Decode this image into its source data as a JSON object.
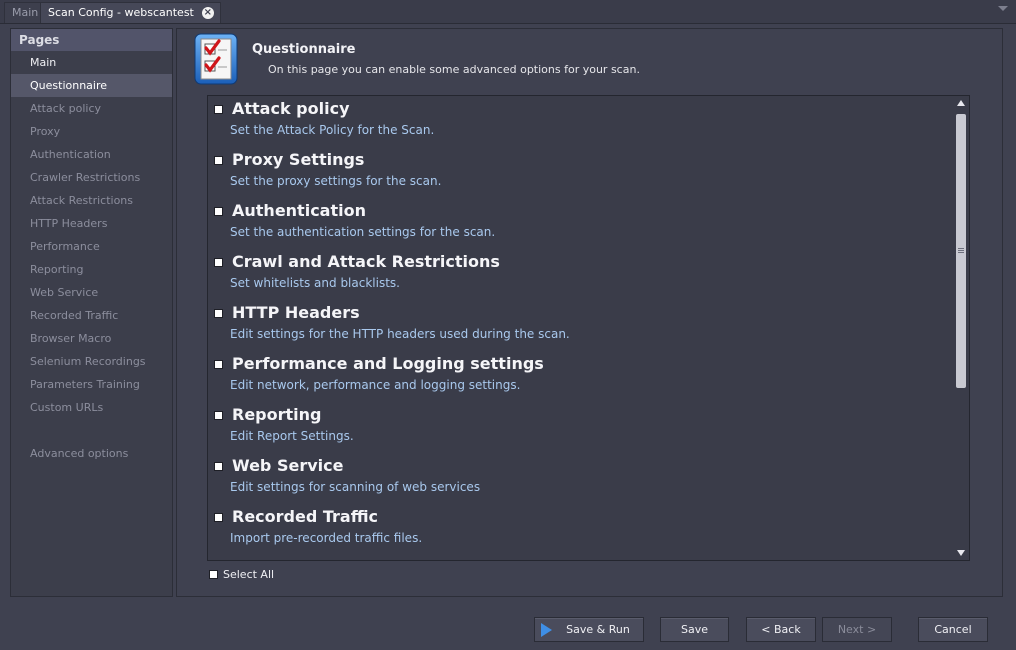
{
  "tabs": [
    {
      "label": "Main",
      "active": false
    },
    {
      "label": "Scan Config - webscantest",
      "active": true
    }
  ],
  "sidebar": {
    "header": "Pages",
    "items": [
      {
        "label": "Main",
        "state": "normal"
      },
      {
        "label": "Questionnaire",
        "state": "selected"
      },
      {
        "label": "Attack policy",
        "state": "disabled"
      },
      {
        "label": "Proxy",
        "state": "disabled"
      },
      {
        "label": "Authentication",
        "state": "disabled"
      },
      {
        "label": "Crawler Restrictions",
        "state": "disabled"
      },
      {
        "label": "Attack Restrictions",
        "state": "disabled"
      },
      {
        "label": "HTTP Headers",
        "state": "disabled"
      },
      {
        "label": "Performance",
        "state": "disabled"
      },
      {
        "label": "Reporting",
        "state": "disabled"
      },
      {
        "label": "Web Service",
        "state": "disabled"
      },
      {
        "label": "Recorded Traffic",
        "state": "disabled"
      },
      {
        "label": "Browser Macro",
        "state": "disabled"
      },
      {
        "label": "Selenium Recordings",
        "state": "disabled"
      },
      {
        "label": "Parameters Training",
        "state": "disabled"
      },
      {
        "label": "Custom URLs",
        "state": "disabled"
      }
    ],
    "advanced_label": "Advanced options"
  },
  "page": {
    "icon": "checklist-icon",
    "title": "Questionnaire",
    "description": "On this page you can enable some advanced options for your scan."
  },
  "options": [
    {
      "title": "Attack policy",
      "desc": "Set the Attack Policy for the Scan.",
      "checked": false
    },
    {
      "title": "Proxy Settings",
      "desc": "Set the proxy settings for the scan.",
      "checked": false
    },
    {
      "title": "Authentication",
      "desc": "Set the authentication settings for the scan.",
      "checked": false
    },
    {
      "title": "Crawl and Attack Restrictions",
      "desc": "Set whitelists and blacklists.",
      "checked": false
    },
    {
      "title": "HTTP Headers",
      "desc": "Edit settings for the HTTP headers used during the scan.",
      "checked": false
    },
    {
      "title": "Performance and Logging settings",
      "desc": "Edit network, performance and logging settings.",
      "checked": false
    },
    {
      "title": "Reporting",
      "desc": "Edit Report Settings.",
      "checked": false
    },
    {
      "title": "Web Service",
      "desc": "Edit settings for scanning of web services",
      "checked": false
    },
    {
      "title": "Recorded Traffic",
      "desc": "Import pre-recorded traffic files.",
      "checked": false
    }
  ],
  "select_all": {
    "label": "Select All",
    "checked": false
  },
  "buttons": {
    "save_run": "Save & Run",
    "save": "Save",
    "back": "< Back",
    "next": "Next >",
    "cancel": "Cancel"
  },
  "colors": {
    "background": "#3f4150",
    "selected_item": "#555769",
    "desc_text": "#a9c9ee",
    "run_icon": "#3f8fe6"
  }
}
